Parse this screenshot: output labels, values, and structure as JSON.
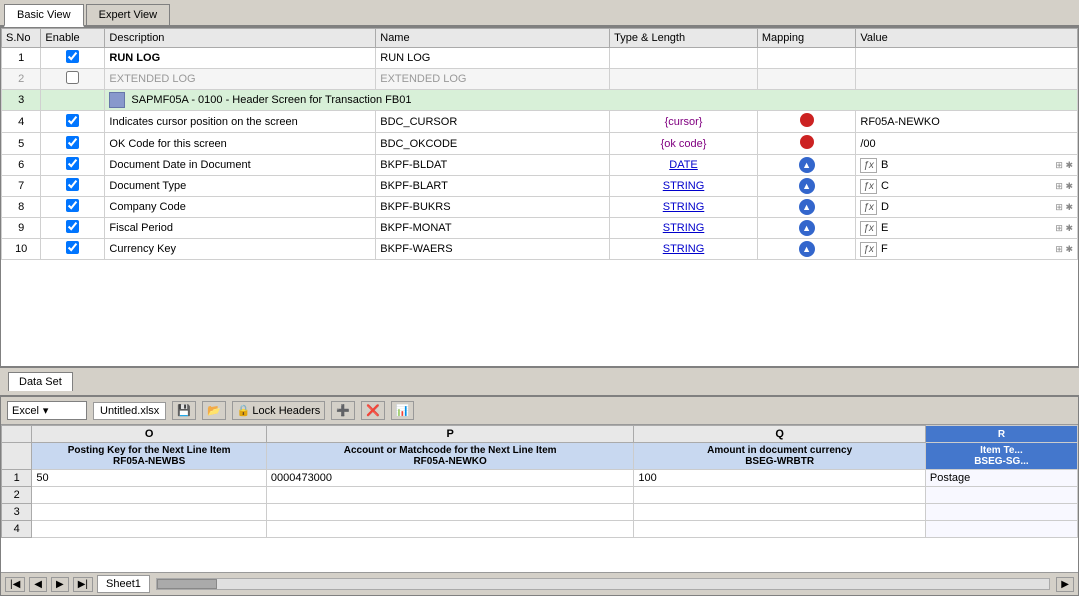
{
  "tabs": [
    {
      "id": "basic",
      "label": "Basic View",
      "active": true
    },
    {
      "id": "expert",
      "label": "Expert View",
      "active": false
    }
  ],
  "table": {
    "columns": [
      "S.No",
      "Enable",
      "Description",
      "Name",
      "Type & Length",
      "Mapping",
      "Value"
    ],
    "rows": [
      {
        "sno": "1",
        "enabled": true,
        "bold": true,
        "desc": "RUN LOG",
        "name": "RUN LOG",
        "type": "",
        "mapping": "",
        "value": "",
        "style": "white"
      },
      {
        "sno": "2",
        "enabled": false,
        "bold": false,
        "desc": "EXTENDED LOG",
        "name": "EXTENDED LOG",
        "type": "",
        "mapping": "",
        "value": "",
        "style": "gray"
      },
      {
        "sno": "3",
        "enabled": true,
        "bold": false,
        "desc": "SAPMF05A - 0100   -   Header Screen for Transaction FB01",
        "name": "",
        "type": "",
        "mapping": "",
        "value": "",
        "style": "green",
        "isHeader": true
      },
      {
        "sno": "4",
        "enabled": true,
        "bold": false,
        "desc": "Indicates cursor position on the screen",
        "name": "BDC_CURSOR",
        "type": "{cursor}",
        "typeColor": "purple",
        "mapping": "red-dot",
        "value": "RF05A-NEWKO",
        "style": "white"
      },
      {
        "sno": "5",
        "enabled": true,
        "bold": false,
        "desc": "OK Code for this screen",
        "name": "BDC_OKCODE",
        "type": "{ok code}",
        "typeColor": "purple",
        "mapping": "red-dot",
        "value": "/00",
        "style": "white"
      },
      {
        "sno": "6",
        "enabled": true,
        "bold": false,
        "desc": "Document Date in Document",
        "name": "BKPF-BLDAT",
        "type": "DATE",
        "typeColor": "blue",
        "mapping": "circle-up",
        "value": "B",
        "hasFx": true,
        "hasGrid": true,
        "style": "white"
      },
      {
        "sno": "7",
        "enabled": true,
        "bold": false,
        "desc": "Document Type",
        "name": "BKPF-BLART",
        "type": "STRING",
        "typeColor": "blue",
        "mapping": "circle-up",
        "value": "C",
        "hasFx": true,
        "hasGrid": true,
        "style": "white"
      },
      {
        "sno": "8",
        "enabled": true,
        "bold": false,
        "desc": "Company Code",
        "name": "BKPF-BUKRS",
        "type": "STRING",
        "typeColor": "blue",
        "mapping": "circle-up",
        "value": "D",
        "hasFx": true,
        "hasGrid": true,
        "style": "white"
      },
      {
        "sno": "9",
        "enabled": true,
        "bold": false,
        "desc": "Fiscal Period",
        "name": "BKPF-MONAT",
        "type": "STRING",
        "typeColor": "blue",
        "mapping": "circle-up",
        "value": "E",
        "hasFx": true,
        "hasGrid": true,
        "style": "white"
      },
      {
        "sno": "10",
        "enabled": true,
        "bold": false,
        "desc": "Currency Key",
        "name": "BKPF-WAERS",
        "type": "STRING",
        "typeColor": "blue",
        "mapping": "circle-up",
        "value": "F",
        "hasFx": true,
        "hasGrid": true,
        "style": "white"
      }
    ]
  },
  "dataset": {
    "section_label": "Data Set",
    "toolbar": {
      "format_label": "Excel",
      "filename": "Untitled.xlsx",
      "lock_headers_label": "Lock Headers"
    },
    "columns": [
      {
        "letter": "O",
        "header1": "Posting Key for the Next Line Item",
        "header2": "RF05A-NEWBS",
        "highlight": false
      },
      {
        "letter": "P",
        "header1": "Account or Matchcode for the Next Line Item",
        "header2": "RF05A-NEWKO",
        "highlight": false
      },
      {
        "letter": "Q",
        "header1": "Amount in document currency",
        "header2": "BSEG-WRBTR",
        "highlight": false
      },
      {
        "letter": "R",
        "header1": "Item Te...",
        "header2": "BSEG-SG...",
        "highlight": true
      }
    ],
    "rows": [
      {
        "rownum": "1",
        "cells": [
          "50",
          "0000473000",
          "100",
          "Postage"
        ]
      },
      {
        "rownum": "2",
        "cells": [
          "",
          "",
          "",
          ""
        ]
      },
      {
        "rownum": "3",
        "cells": [
          "",
          "",
          "",
          ""
        ]
      },
      {
        "rownum": "4",
        "cells": [
          "",
          "",
          "",
          ""
        ]
      }
    ],
    "sheet_name": "Sheet1"
  }
}
